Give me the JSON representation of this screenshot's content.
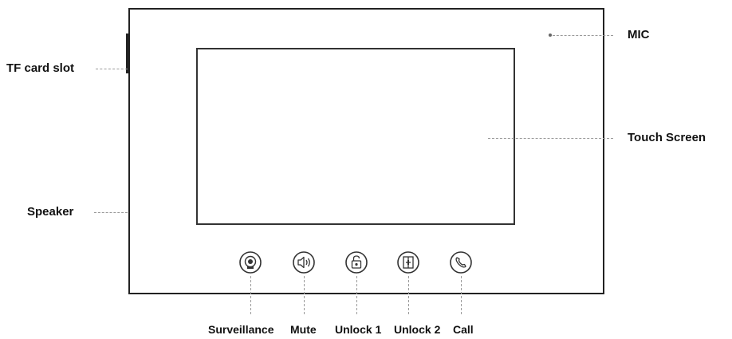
{
  "labels": {
    "tf_card_slot": "TF card slot",
    "speaker": "Speaker",
    "mic": "MIC",
    "touch_screen": "Touch Screen"
  },
  "buttons": [
    {
      "label": "Surveillance",
      "icon": "camera-icon"
    },
    {
      "label": "Mute",
      "icon": "speaker-icon"
    },
    {
      "label": "Unlock 1",
      "icon": "unlock-icon"
    },
    {
      "label": "Unlock 2",
      "icon": "door-icon"
    },
    {
      "label": "Call",
      "icon": "phone-icon"
    }
  ],
  "colors": {
    "outline": "#222222",
    "leader": "#9a9a9a",
    "text": "#111111"
  }
}
